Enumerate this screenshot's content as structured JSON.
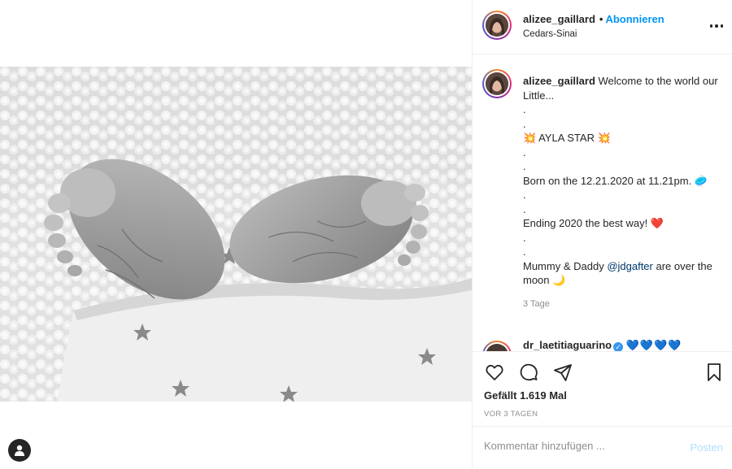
{
  "header": {
    "username": "alizee_gaillard",
    "separator": "•",
    "follow_label": "Abonnieren",
    "location": "Cedars-Sinai"
  },
  "caption": {
    "username": "alizee_gaillard",
    "lines": [
      "Welcome to the world our Little...",
      ".",
      ".",
      "💥 AYLA STAR 💥",
      ".",
      ".",
      "Born on the 12.21.2020 at 11.21pm. 🥏",
      ".",
      ".",
      "Ending 2020 the best way! ❤️",
      ".",
      "."
    ],
    "final_line_before": "Mummy & Daddy ",
    "mention": "@jdgafter",
    "final_line_after": " are over the moon 🌙",
    "time": "3 Tage"
  },
  "next_comment": {
    "username": "dr_laetitiaguarino",
    "verified_mark": "✓",
    "text": "💙💙💙💙"
  },
  "actions": {
    "likes": "Gefällt 1.619 Mal",
    "posted_ago": "VOR 3 TAGEN"
  },
  "comment_box": {
    "placeholder": "Kommentar hinzufügen ...",
    "post_label": "Posten"
  },
  "colors": {
    "accent": "#0095f6",
    "post_disabled": "#b2dffc",
    "mention": "#00376b"
  }
}
